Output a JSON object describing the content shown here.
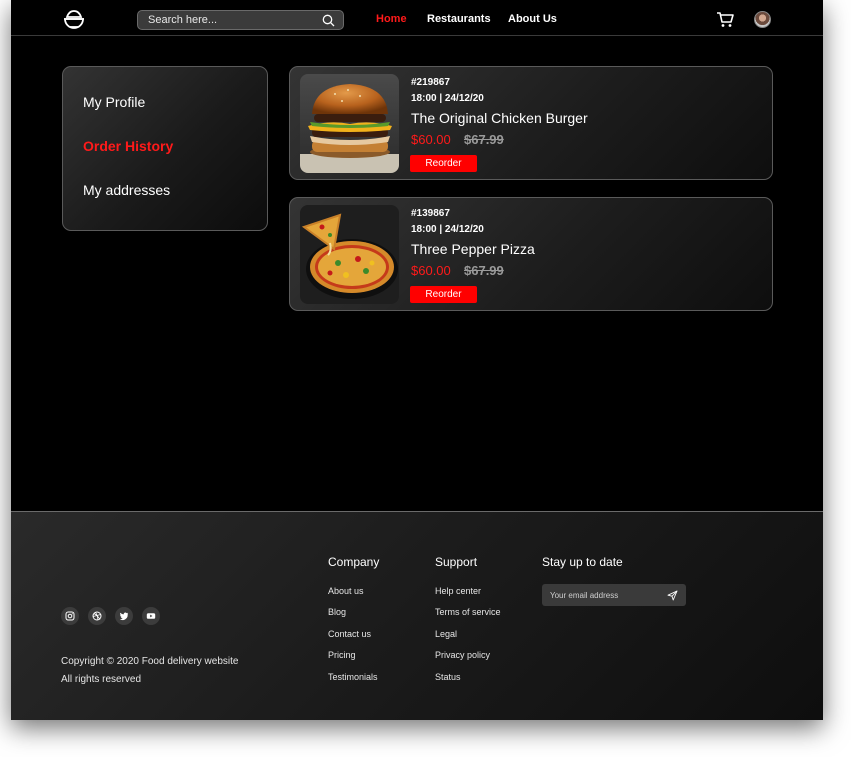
{
  "header": {
    "search_placeholder": "Search here...",
    "nav": {
      "home": "Home",
      "restaurants": "Restaurants",
      "about": "About Us"
    },
    "active_color": "#ff1a1a"
  },
  "sidebar": {
    "items": [
      "My Profile",
      "Order History",
      "My addresses"
    ],
    "active": "Order History"
  },
  "orders": [
    {
      "id": "#219867",
      "time": "18:00 | 24/12/20",
      "name": "The Original Chicken Burger",
      "price": "$60.00",
      "old_price": "$67.99",
      "button": "Reorder",
      "image": "burger"
    },
    {
      "id": "#139867",
      "time": "18:00 | 24/12/20",
      "name": "Three Pepper Pizza",
      "price": "$60.00",
      "old_price": "$67.99",
      "button": "Reorder",
      "image": "pizza"
    }
  ],
  "footer": {
    "socials": [
      "instagram-icon",
      "dribbble-icon",
      "twitter-icon",
      "youtube-icon"
    ],
    "copyright": "Copyright © 2020 Food delivery website",
    "rights": "All rights reserved",
    "company": {
      "title": "Company",
      "links": [
        "About us",
        "Blog",
        "Contact us",
        "Pricing",
        "Testimonials"
      ]
    },
    "support": {
      "title": "Support",
      "links": [
        "Help center",
        "Terms of service",
        "Legal",
        "Privacy policy",
        "Status"
      ]
    },
    "newsletter": {
      "title": "Stay up to date",
      "placeholder": "Your email address"
    }
  },
  "colors": {
    "accent": "#ff0000",
    "background": "#000000",
    "card_border": "#5a5a5a"
  }
}
